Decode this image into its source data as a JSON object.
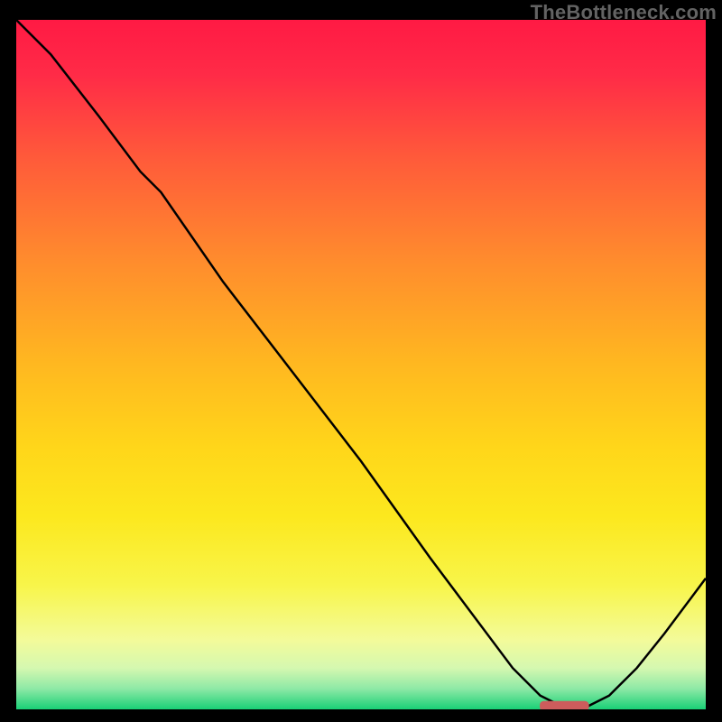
{
  "watermark": "TheBottleneck.com",
  "chart_data": {
    "type": "line",
    "title": "",
    "xlabel": "",
    "ylabel": "",
    "xlim": [
      0,
      100
    ],
    "ylim": [
      0,
      100
    ],
    "grid": false,
    "background": "vertical gradient red-to-yellow-to-green",
    "series": [
      {
        "name": "curve",
        "x": [
          0,
          5,
          12,
          18,
          21,
          30,
          40,
          50,
          60,
          66,
          72,
          76,
          80,
          82,
          86,
          90,
          94,
          100
        ],
        "y": [
          100,
          95,
          86,
          78,
          75,
          62,
          49,
          36,
          22,
          14,
          6,
          2,
          0,
          0,
          2,
          6,
          11,
          19
        ]
      }
    ],
    "marker": {
      "name": "selected-range",
      "x_start": 76,
      "x_end": 83,
      "y": 0.5
    }
  }
}
